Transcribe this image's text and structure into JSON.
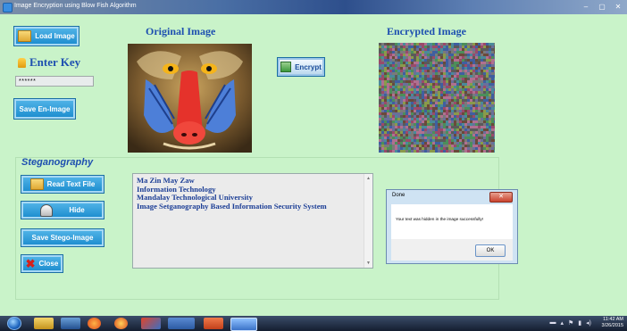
{
  "window": {
    "title": "Image Encryption using Blow Fish Algorithm",
    "controls": [
      "–",
      "▢",
      "✕"
    ]
  },
  "main": {
    "load_image_label": "Load Image",
    "enter_key_label": "Enter Key",
    "key_value": "******",
    "save_en_image_label": "Save En-Image",
    "original_image_heading": "Original Image",
    "encrypted_image_heading": "Encrypted Image",
    "encrypt_label": "Encrypt"
  },
  "steganography": {
    "title": "Steganography",
    "read_text_file_label": "Read Text File",
    "hide_label": "Hide",
    "save_stego_image_label": "Save Stego-Image",
    "close_label": "Close",
    "text_lines": [
      "Ma Zin May Zaw",
      "Information Technology",
      "Mandalay Technological University",
      "Image Setganography Based Information Security System"
    ]
  },
  "dialog": {
    "title": "Done",
    "message": "Your text was hidden in the image successfully!",
    "ok_label": "OK"
  },
  "taskbar": {
    "time": "11:42 AM",
    "date": "3/26/2015"
  },
  "colors": {
    "background": "#c9f3c9",
    "heading": "#1d4fb0",
    "button": "#1f8fd0"
  },
  "icons": {
    "load": "folder-icon",
    "read": "folder-icon",
    "hide": "person-icon",
    "close": "close-x-icon",
    "enter_key": "key-icon"
  }
}
